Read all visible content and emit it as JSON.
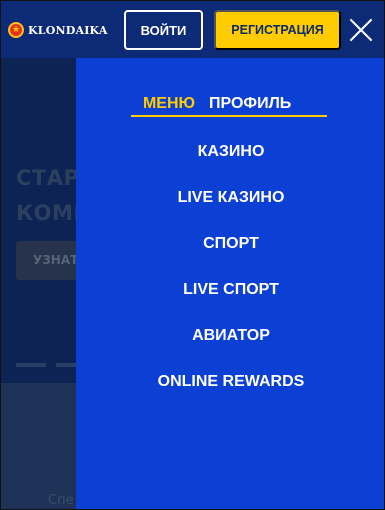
{
  "header": {
    "logo_text": "KLONDAIKA",
    "login_label": "ВОЙТИ",
    "register_label": "РЕГИСТРАЦИЯ"
  },
  "menu": {
    "tabs": [
      {
        "label": "МЕНЮ",
        "active": true
      },
      {
        "label": "ПРОФИЛЬ",
        "active": false
      }
    ],
    "items": [
      {
        "label": "КАЗИНО"
      },
      {
        "label": "LIVE КАЗИНО"
      },
      {
        "label": "СПОРТ"
      },
      {
        "label": "LIVE СПОРТ"
      },
      {
        "label": "АВИАТОР"
      },
      {
        "label": "ONLINE REWARDS"
      }
    ]
  },
  "background_page": {
    "heading_line1": "СТАРТ",
    "heading_line2": "КОМП",
    "button_label": "УЗНАТЬ",
    "footer_text": "Спе"
  },
  "colors": {
    "header_bg": "#0c2a75",
    "menu_bg": "#0c3fd4",
    "accent_yellow": "#fecc00",
    "text_white": "#ffffff"
  },
  "icons": {
    "logo": "klondaika-star-badge-icon",
    "close": "close-icon"
  }
}
